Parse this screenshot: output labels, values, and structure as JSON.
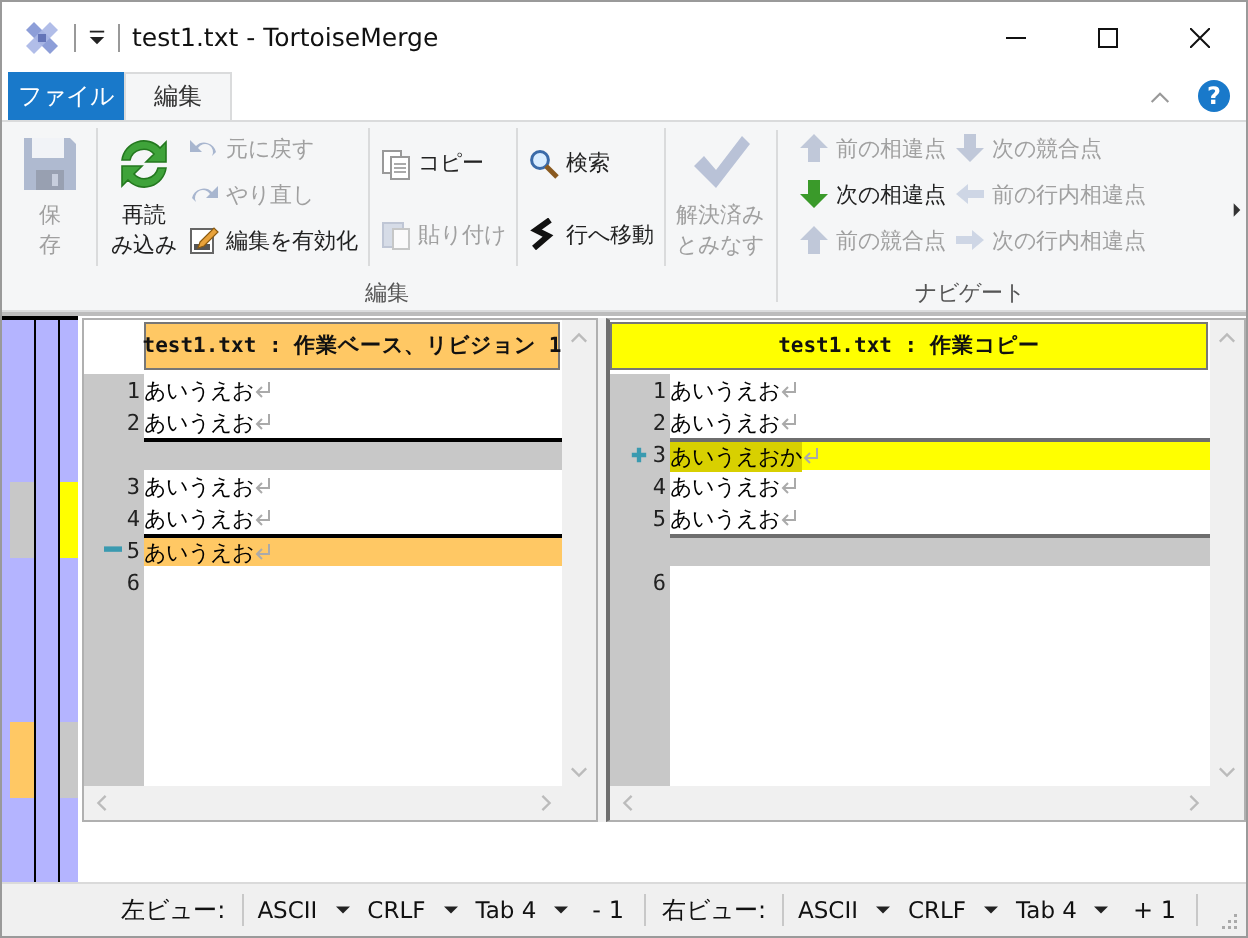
{
  "window": {
    "title": "test1.txt - TortoiseMerge"
  },
  "tabs": [
    {
      "label": "ファイル",
      "kind": "backstage",
      "selected": false
    },
    {
      "label": "編集",
      "kind": "tab",
      "selected": true
    }
  ],
  "help": {
    "label": "?"
  },
  "ribbon": {
    "groups": [
      {
        "label": "編集",
        "items": [
          {
            "kind": "large",
            "label_lines": [
              "保",
              "存"
            ],
            "disabled": true
          },
          {
            "kind": "separator"
          },
          {
            "kind": "large",
            "label_lines": [
              "再読",
              "み込み"
            ],
            "disabled": false
          },
          {
            "kind": "stack",
            "buttons": [
              {
                "label": "元に戻す",
                "disabled": true
              },
              {
                "label": "やり直し",
                "disabled": true
              },
              {
                "label": "編集を有効化",
                "disabled": false
              }
            ]
          },
          {
            "kind": "separator"
          },
          {
            "kind": "stack",
            "buttons": [
              {
                "label": "コピー",
                "disabled": false
              },
              {
                "label": "貼り付け",
                "disabled": true
              }
            ]
          },
          {
            "kind": "separator"
          },
          {
            "kind": "stack",
            "buttons": [
              {
                "label": "検索",
                "disabled": false
              },
              {
                "label": "行へ移動",
                "disabled": false
              }
            ]
          },
          {
            "kind": "separator"
          },
          {
            "kind": "large",
            "label_lines": [
              "解決済み",
              "とみなす"
            ],
            "disabled": true
          }
        ]
      },
      {
        "label": "ナビゲート",
        "items": [
          {
            "kind": "stack",
            "buttons": [
              {
                "label": "前の相違点",
                "disabled": true
              },
              {
                "label": "次の相違点",
                "disabled": false
              },
              {
                "label": "前の競合点",
                "disabled": true
              }
            ]
          },
          {
            "kind": "stack",
            "buttons": [
              {
                "label": "次の競合点",
                "disabled": true
              },
              {
                "label": "前の行内相違点",
                "disabled": true
              },
              {
                "label": "次の行内相違点",
                "disabled": true
              }
            ]
          }
        ]
      }
    ]
  },
  "panes": [
    {
      "header": "test1.txt : 作業ベース、リビジョン 1",
      "lines": [
        {
          "number": "1",
          "text": "あいうえお",
          "kind": "normal",
          "boundary": false
        },
        {
          "number": "2",
          "text": "あいうえお",
          "kind": "normal",
          "boundary": false
        },
        {
          "kind": "empty",
          "boundary": true
        },
        {
          "number": "3",
          "text": "あいうえお",
          "kind": "normal",
          "boundary": false
        },
        {
          "number": "4",
          "text": "あいうえお",
          "kind": "normal",
          "boundary": false
        },
        {
          "number": "5",
          "text": "あいうえお",
          "kind": "removed",
          "boundary": true
        },
        {
          "number": "6",
          "kind": "last",
          "boundary": false
        }
      ]
    },
    {
      "header": "test1.txt : 作業コピー",
      "lines": [
        {
          "number": "1",
          "text": "あいうえお",
          "kind": "normal",
          "boundary": false
        },
        {
          "number": "2",
          "text": "あいうえお",
          "kind": "normal",
          "boundary": false
        },
        {
          "number": "3",
          "text": "あいうえおか",
          "kind": "added",
          "boundary": true
        },
        {
          "number": "4",
          "text": "あいうえお",
          "kind": "normal",
          "boundary": false
        },
        {
          "number": "5",
          "text": "あいうえお",
          "kind": "normal",
          "boundary": false
        },
        {
          "kind": "empty",
          "boundary": true
        },
        {
          "number": "6",
          "kind": "last",
          "boundary": false
        }
      ]
    }
  ],
  "status_bar": {
    "items": [
      {
        "kind": "label",
        "text": "左ビュー:"
      },
      {
        "kind": "dropdown",
        "text": "ASCII"
      },
      {
        "kind": "dropdown",
        "text": "CRLF"
      },
      {
        "kind": "dropdown",
        "text": "Tab 4"
      },
      {
        "kind": "count",
        "text": "- 1"
      },
      {
        "kind": "label",
        "text": "右ビュー:"
      },
      {
        "kind": "dropdown",
        "text": "ASCII"
      },
      {
        "kind": "dropdown",
        "text": "CRLF"
      },
      {
        "kind": "dropdown",
        "text": "Tab 4"
      },
      {
        "kind": "count",
        "text": "+ 1"
      }
    ]
  }
}
